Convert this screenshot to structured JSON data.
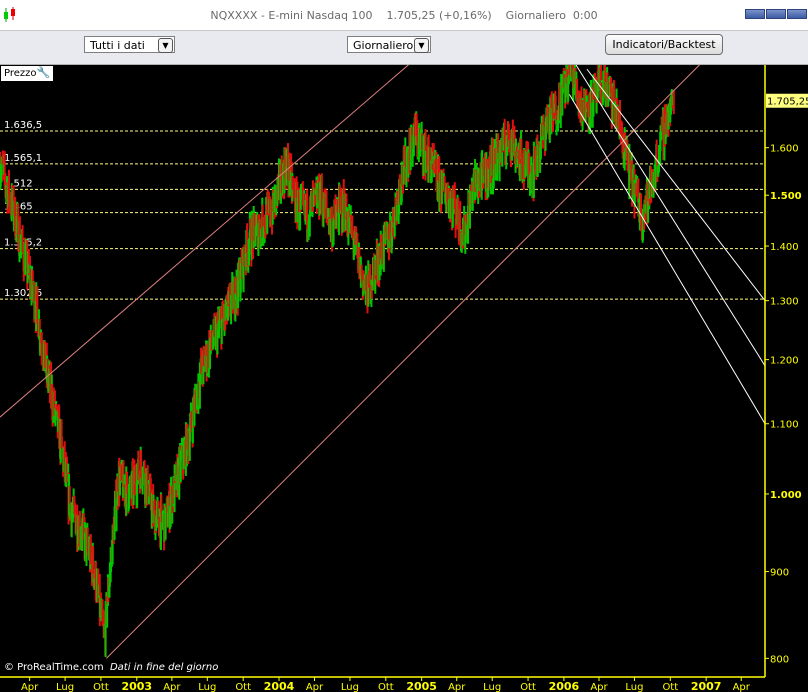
{
  "window": {
    "title": "NQXXXX - E-mini Nasdaq 100    1.705,25 (+0,16%)    Giornaliero  0:00"
  },
  "toolbar": {
    "range_select": "Tutti i dati",
    "period_select": "Giornaliero",
    "indicators_button": "Indicatori/Backtest"
  },
  "panel": {
    "tab_label": "Prezzo",
    "settings_icon": "wrench-icon"
  },
  "footer": {
    "brand": "© ProRealTime.com",
    "note": "Dati in fine del giorno"
  },
  "colors": {
    "background": "#000000",
    "up_bar": "#00c800",
    "down_bar": "#e01010",
    "level_line": "#ffff80",
    "channel_line": "#e08080",
    "downtrend_line": "#ffffff",
    "axis": "#ffff00"
  },
  "chart_data": {
    "type": "bar",
    "title": "NQXXXX - E-mini Nasdaq 100",
    "last_price_label": "1.705,25",
    "last_price": 1705.25,
    "y_axis": {
      "scale": "log",
      "ylim": [
        780,
        1790
      ],
      "ticks": [
        {
          "value": 1600,
          "label": "1.600"
        },
        {
          "value": 1500,
          "label": "1.500",
          "bold": true
        },
        {
          "value": 1400,
          "label": "1.400"
        },
        {
          "value": 1300,
          "label": "1.300"
        },
        {
          "value": 1200,
          "label": "1.200"
        },
        {
          "value": 1100,
          "label": "1.100"
        },
        {
          "value": 1000,
          "label": "1.000",
          "bold": true
        },
        {
          "value": 900,
          "label": "900"
        },
        {
          "value": 800,
          "label": "800"
        }
      ]
    },
    "x_axis": {
      "xlim": [
        "2002-01-15",
        "2007-06-01"
      ],
      "ticks": [
        {
          "date": "2002-04-01",
          "label": "Apr"
        },
        {
          "date": "2002-07-01",
          "label": "Lug"
        },
        {
          "date": "2002-10-01",
          "label": "Ott"
        },
        {
          "date": "2003-01-01",
          "label": "2003",
          "bold": true
        },
        {
          "date": "2003-04-01",
          "label": "Apr"
        },
        {
          "date": "2003-07-01",
          "label": "Lug"
        },
        {
          "date": "2003-10-01",
          "label": "Ott"
        },
        {
          "date": "2004-01-01",
          "label": "2004",
          "bold": true
        },
        {
          "date": "2004-04-01",
          "label": "Apr"
        },
        {
          "date": "2004-07-01",
          "label": "Lug"
        },
        {
          "date": "2004-10-01",
          "label": "Ott"
        },
        {
          "date": "2005-01-01",
          "label": "2005",
          "bold": true
        },
        {
          "date": "2005-04-01",
          "label": "Apr"
        },
        {
          "date": "2005-07-01",
          "label": "Lug"
        },
        {
          "date": "2005-10-01",
          "label": "Ott"
        },
        {
          "date": "2006-01-01",
          "label": "2006",
          "bold": true
        },
        {
          "date": "2006-04-01",
          "label": "Apr"
        },
        {
          "date": "2006-07-01",
          "label": "Lug"
        },
        {
          "date": "2006-10-01",
          "label": "Ott"
        },
        {
          "date": "2007-01-01",
          "label": "2007",
          "bold": true
        },
        {
          "date": "2007-04-01",
          "label": "Apr"
        }
      ]
    },
    "horizontal_levels": [
      {
        "value": 1636.5,
        "label": "1.636,5"
      },
      {
        "value": 1565.1,
        "label": "1.565,1"
      },
      {
        "value": 1512,
        "label": "1.512"
      },
      {
        "value": 1465,
        "label": "1.465"
      },
      {
        "value": 1395.2,
        "label": "1.395,2"
      },
      {
        "value": 1302.6,
        "label": "1.302,6"
      }
    ],
    "trendlines": [
      {
        "name": "channel-upper",
        "from": [
          "2002-01-15",
          1110
        ],
        "to": [
          "2005-01-15",
          1830
        ]
      },
      {
        "name": "channel-lower",
        "from": [
          "2002-10-15",
          800
        ],
        "to": [
          "2007-01-15",
          1820
        ]
      },
      {
        "name": "downtrend-1",
        "from": [
          "2006-01-15",
          1720
        ],
        "to": [
          "2007-06-01",
          1100
        ]
      },
      {
        "name": "downtrend-2",
        "from": [
          "2006-02-01",
          1790
        ],
        "to": [
          "2007-06-01",
          1190
        ]
      },
      {
        "name": "downtrend-3",
        "from": [
          "2006-03-01",
          1780
        ],
        "to": [
          "2007-06-01",
          1300
        ]
      }
    ],
    "price_path": [
      [
        "2002-01-15",
        1565
      ],
      [
        "2002-02-15",
        1480
      ],
      [
        "2002-03-15",
        1390
      ],
      [
        "2002-04-15",
        1300
      ],
      [
        "2002-05-15",
        1180
      ],
      [
        "2002-06-15",
        1090
      ],
      [
        "2002-07-15",
        980
      ],
      [
        "2002-08-15",
        950
      ],
      [
        "2002-09-15",
        900
      ],
      [
        "2002-10-10",
        820
      ],
      [
        "2002-11-15",
        1020
      ],
      [
        "2002-12-15",
        1000
      ],
      [
        "2003-01-15",
        1040
      ],
      [
        "2003-02-15",
        970
      ],
      [
        "2003-03-15",
        960
      ],
      [
        "2003-04-15",
        1020
      ],
      [
        "2003-05-15",
        1080
      ],
      [
        "2003-06-15",
        1180
      ],
      [
        "2003-07-15",
        1230
      ],
      [
        "2003-08-15",
        1270
      ],
      [
        "2003-09-15",
        1320
      ],
      [
        "2003-10-15",
        1410
      ],
      [
        "2003-11-15",
        1440
      ],
      [
        "2003-12-15",
        1470
      ],
      [
        "2004-01-20",
        1565
      ],
      [
        "2004-02-15",
        1480
      ],
      [
        "2004-03-15",
        1460
      ],
      [
        "2004-04-15",
        1500
      ],
      [
        "2004-05-15",
        1440
      ],
      [
        "2004-06-15",
        1480
      ],
      [
        "2004-07-15",
        1400
      ],
      [
        "2004-08-12",
        1310
      ],
      [
        "2004-09-15",
        1380
      ],
      [
        "2004-10-15",
        1430
      ],
      [
        "2004-11-15",
        1550
      ],
      [
        "2004-12-15",
        1630
      ],
      [
        "2005-01-15",
        1580
      ],
      [
        "2005-02-15",
        1520
      ],
      [
        "2005-03-15",
        1500
      ],
      [
        "2005-04-20",
        1420
      ],
      [
        "2005-05-15",
        1520
      ],
      [
        "2005-06-15",
        1540
      ],
      [
        "2005-07-15",
        1580
      ],
      [
        "2005-08-15",
        1625
      ],
      [
        "2005-09-15",
        1570
      ],
      [
        "2005-10-15",
        1550
      ],
      [
        "2005-11-15",
        1650
      ],
      [
        "2005-12-15",
        1690
      ],
      [
        "2006-01-20",
        1780
      ],
      [
        "2006-02-15",
        1690
      ],
      [
        "2006-03-15",
        1700
      ],
      [
        "2006-04-15",
        1750
      ],
      [
        "2006-05-15",
        1680
      ],
      [
        "2006-06-15",
        1560
      ],
      [
        "2006-07-20",
        1460
      ],
      [
        "2006-08-15",
        1520
      ],
      [
        "2006-09-15",
        1640
      ],
      [
        "2006-10-10",
        1705
      ]
    ]
  }
}
